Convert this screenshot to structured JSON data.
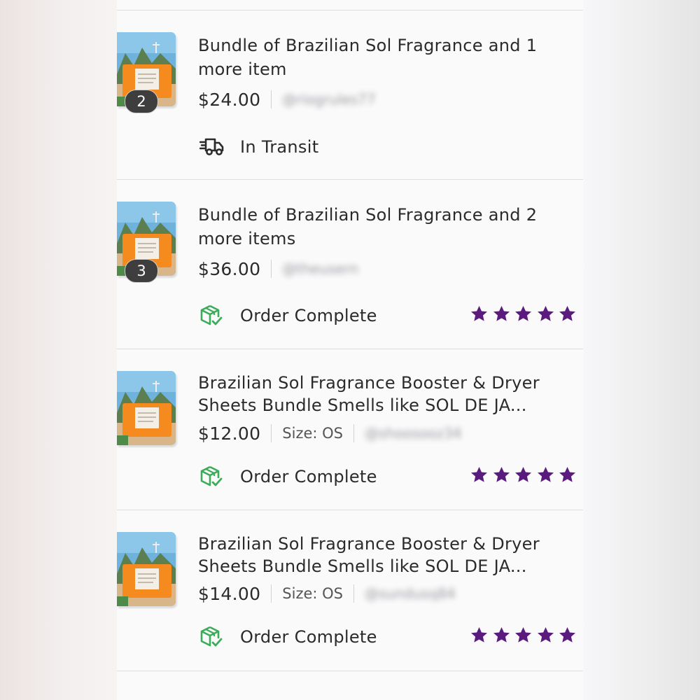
{
  "colors": {
    "star": "#5a1a7e",
    "complete_icon": "#3cab5a",
    "badge": "#3e3e3e"
  },
  "orders": [
    {
      "title": "Bundle of Brazilian Sol Fragrance and 1 more item",
      "item_count": "2",
      "price": "$24.00",
      "size": "",
      "seller": "@riogrules77",
      "status": "In Transit",
      "status_icon": "delivery-truck-icon",
      "rating": 0
    },
    {
      "title": "Bundle of Brazilian Sol Fragrance and 2 more items",
      "item_count": "3",
      "price": "$36.00",
      "size": "",
      "seller": "@theusern",
      "status": "Order Complete",
      "status_icon": "package-check-icon",
      "rating": 5
    },
    {
      "title": "Brazilian Sol Fragrance Booster & Dryer Sheets Bundle Smells like SOL DE JA...",
      "item_count": "",
      "price": "$12.00",
      "size": "Size: OS",
      "seller": "@shoosooz34",
      "status": "Order Complete",
      "status_icon": "package-check-icon",
      "rating": 5
    },
    {
      "title": "Brazilian Sol Fragrance Booster & Dryer Sheets Bundle Smells like SOL DE JA...",
      "item_count": "",
      "price": "$14.00",
      "size": "Size: OS",
      "seller": "@sundusq84",
      "status": "Order Complete",
      "status_icon": "package-check-icon",
      "rating": 5
    }
  ]
}
